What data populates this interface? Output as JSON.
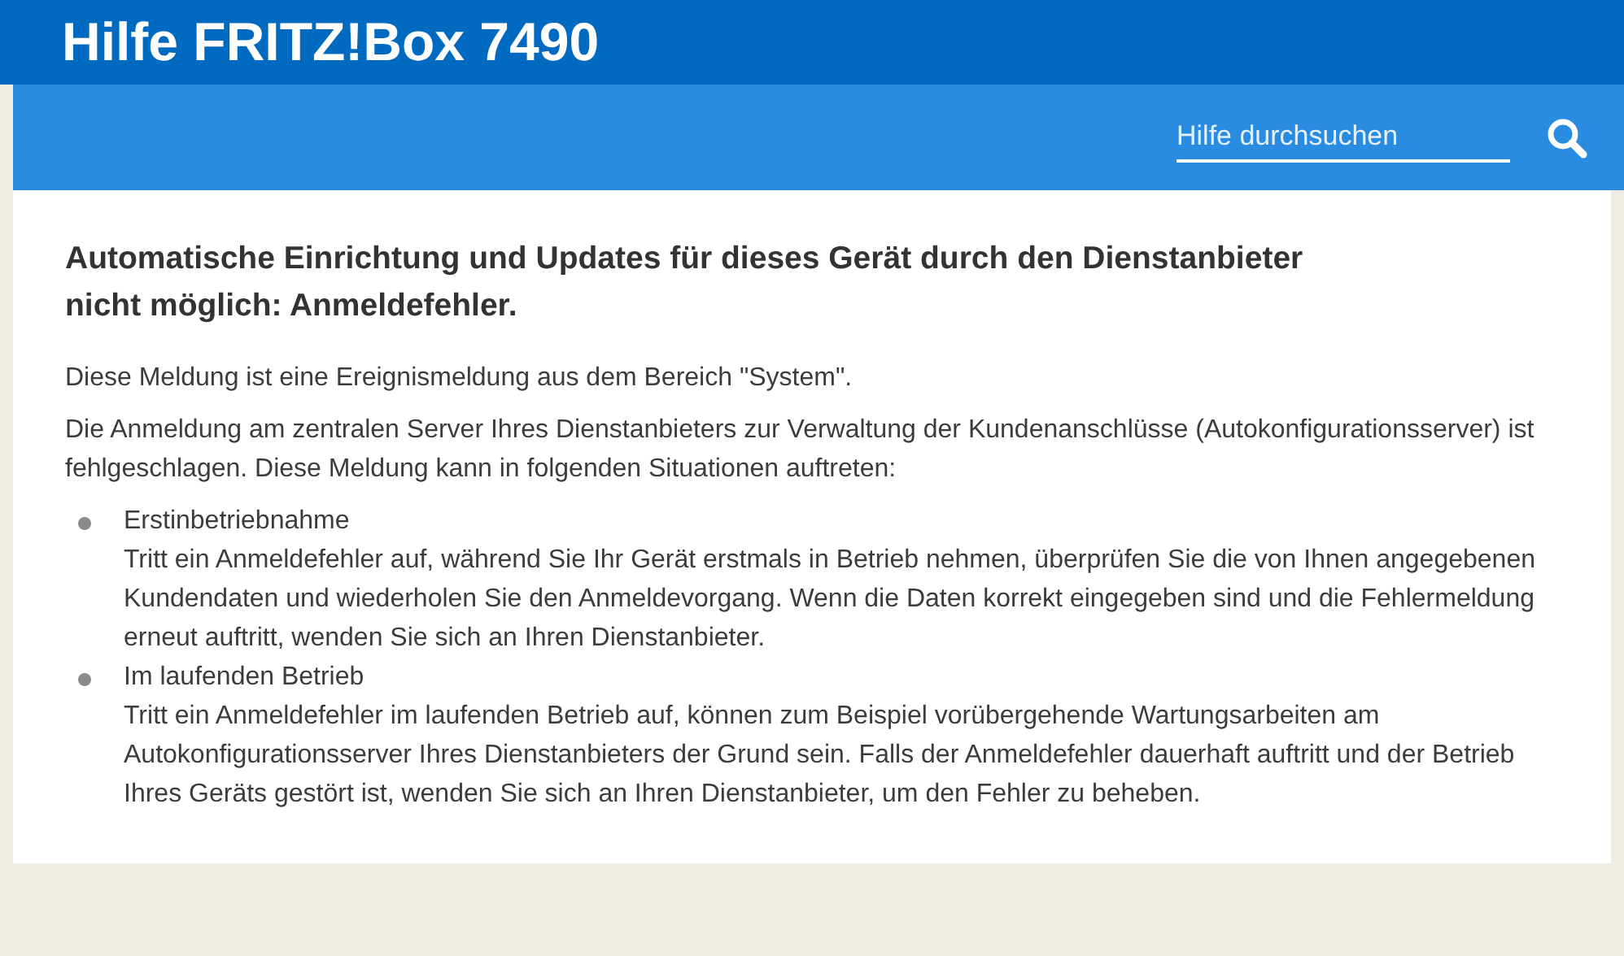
{
  "header": {
    "title": "Hilfe FRITZ!Box 7490"
  },
  "search": {
    "placeholder": "Hilfe durchsuchen"
  },
  "article": {
    "heading": "Automatische Einrichtung und Updates für dieses Gerät durch den Dienstanbieter nicht möglich: Anmeldefehler.",
    "paragraphs": [
      "Diese Meldung ist eine Ereignismeldung aus dem Bereich \"System\".",
      "Die Anmeldung am zentralen Server Ihres Dienstanbieters zur Verwaltung der Kundenanschlüsse (Autokonfigurationsserver) ist fehlgeschlagen. Diese Meldung kann in folgenden Situationen auftreten:"
    ],
    "items": [
      {
        "title": "Erstinbetriebnahme",
        "text": "Tritt ein Anmeldefehler auf, während Sie Ihr Gerät erstmals in Betrieb nehmen, überprüfen Sie die von Ihnen angegebenen Kundendaten und wiederholen Sie den Anmeldevorgang. Wenn die Daten korrekt eingegeben sind und die Fehlermeldung erneut auftritt, wenden Sie sich an Ihren Dienstanbieter."
      },
      {
        "title": "Im laufenden Betrieb",
        "text": "Tritt ein Anmeldefehler im laufenden Betrieb auf, können zum Beispiel vorübergehende Wartungsarbeiten am Autokonfigurationsserver Ihres Dienstanbieters der Grund sein. Falls der Anmeldefehler dauerhaft auftritt und der Betrieb Ihres Geräts gestört ist, wenden Sie sich an Ihren Dienstanbieter, um den Fehler zu beheben."
      }
    ]
  }
}
